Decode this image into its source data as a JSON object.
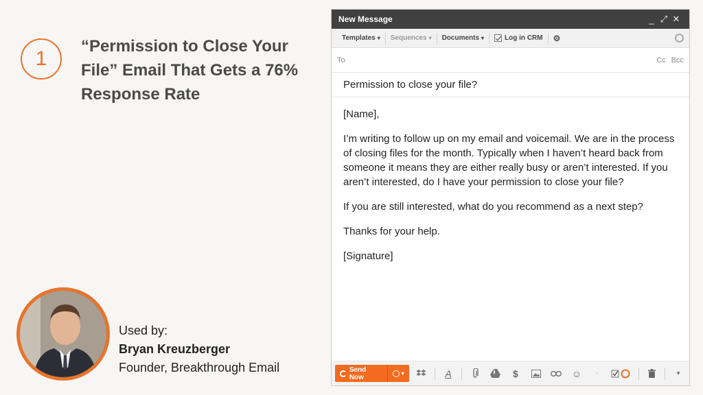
{
  "slide": {
    "number": "1",
    "headline": "“Permission to Close Your File” Email That Gets a 76% Response Rate",
    "used_by_label": "Used by:",
    "author_name": "Bryan Kreuzberger",
    "author_title": "Founder, Breakthrough Email"
  },
  "window": {
    "title": "New Message",
    "controls": [
      "_",
      "⤢",
      "✕"
    ]
  },
  "toolbar": {
    "templates": "Templates",
    "sequences": "Sequences",
    "documents": "Documents",
    "log_in_crm": "Log in CRM"
  },
  "compose": {
    "to_label": "To",
    "cc": "Cc",
    "bcc": "Bcc",
    "subject": "Permission to close your file?",
    "body": [
      "[Name],",
      "I’m writing to follow up on my email and voicemail. We are in the process of closing files for the month. Typically when I haven’t heard back from someone it means they are either really busy or aren’t interested. If you aren’t interested, do I have your permission to close your file?",
      "If you are still interested, what do you recommend as a next step?",
      "Thanks for your help.",
      "[Signature]"
    ]
  },
  "bottom": {
    "send_label": "Send Now"
  },
  "colors": {
    "accent": "#e8742c",
    "send_button": "#f26b21",
    "titlebar": "#404040"
  },
  "icons": [
    "dropbox-icon",
    "format-text-icon",
    "attach-icon",
    "drive-icon",
    "dollar-icon",
    "photo-icon",
    "link-icon",
    "emoji-icon",
    "track-icon",
    "trash-icon",
    "more-options-icon"
  ]
}
